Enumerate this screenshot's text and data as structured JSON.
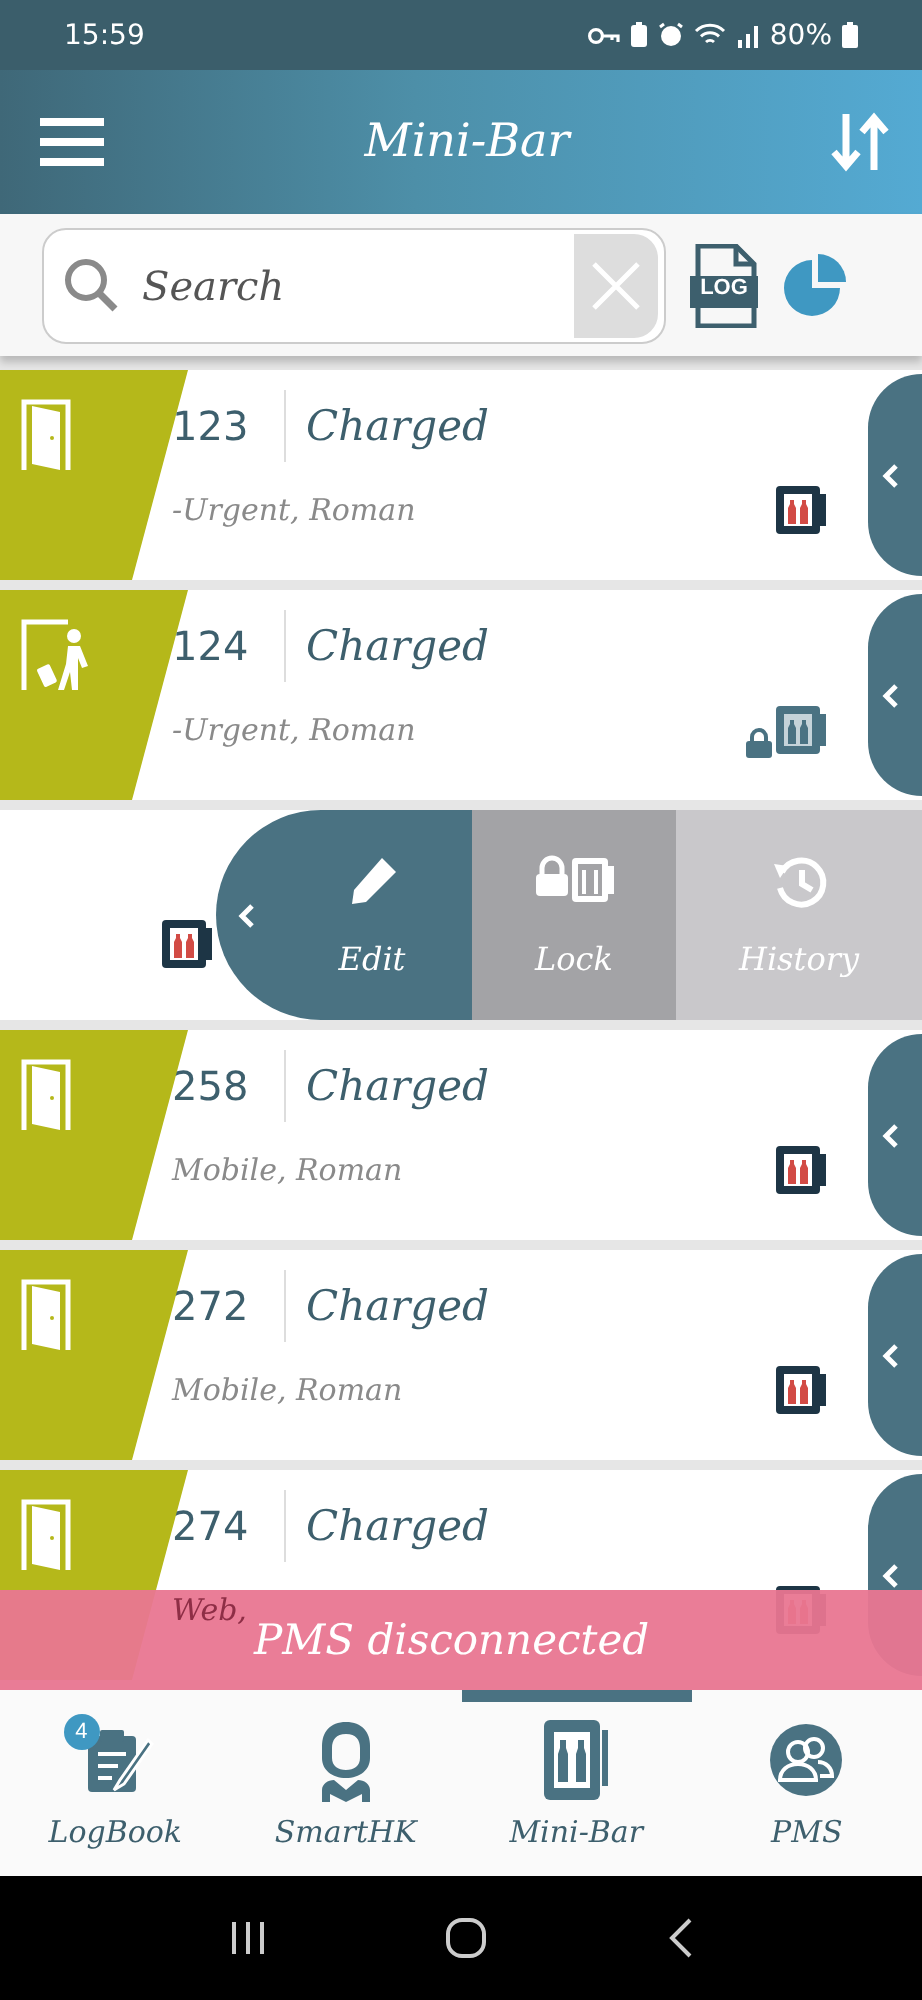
{
  "status_bar": {
    "time": "15:59",
    "battery": "80%"
  },
  "header": {
    "title": "Mini-Bar"
  },
  "search": {
    "placeholder": "Search"
  },
  "toolbar": {
    "log_label": "LOG"
  },
  "rows": [
    {
      "kind": "room",
      "room": "123",
      "status": "Charged",
      "subtitle": "-Urgent, Roman",
      "room_icon": {
        "kind": "door"
      },
      "minibar_locked": false
    },
    {
      "kind": "room",
      "room": "124",
      "status": "Charged",
      "subtitle": "-Urgent, Roman",
      "room_icon": {
        "kind": "departure"
      },
      "minibar_locked": true
    },
    {
      "kind": "swiped",
      "minibar_locked": false,
      "actions": [
        {
          "kind": "edit",
          "label": "Edit"
        },
        {
          "kind": "lock",
          "label": "Lock"
        },
        {
          "kind": "history",
          "label": "History"
        }
      ]
    },
    {
      "kind": "room",
      "room": "258",
      "status": "Charged",
      "subtitle": "Mobile, Roman",
      "room_icon": {
        "kind": "door"
      },
      "minibar_locked": false
    },
    {
      "kind": "room",
      "room": "272",
      "status": "Charged",
      "subtitle": "Mobile, Roman",
      "room_icon": {
        "kind": "door"
      },
      "minibar_locked": false
    },
    {
      "kind": "room",
      "room": "274",
      "status": "Charged",
      "subtitle": "Web,",
      "room_icon": {
        "kind": "door"
      },
      "minibar_locked": false
    }
  ],
  "toast": "PMS disconnected",
  "tabs": [
    {
      "kind": "logbook",
      "label": "LogBook",
      "selected": false,
      "badge": "4"
    },
    {
      "kind": "smarthk",
      "label": "SmartHK",
      "selected": false
    },
    {
      "kind": "minibar",
      "label": "Mini-Bar",
      "selected": true
    },
    {
      "kind": "pms",
      "label": "PMS",
      "selected": false
    }
  ]
}
